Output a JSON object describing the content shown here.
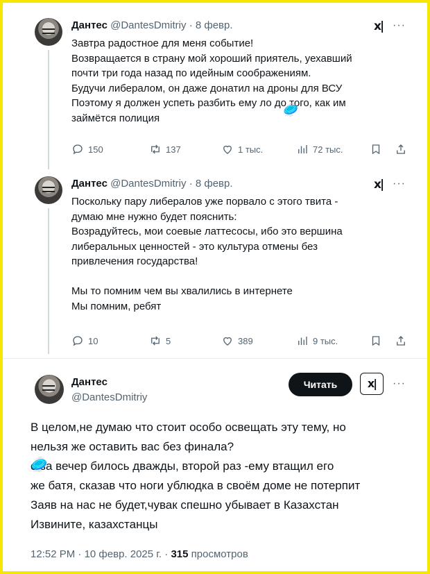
{
  "tweets": [
    {
      "name": "Дантес",
      "handle": "@DantesDmitriy",
      "dot": "·",
      "date": "8 февр.",
      "text": "Завтра радостное для меня событие!\nВозвращается в страну мой хороший приятель, уехавший\nпочти три года назад по идейным соображениям.\nБудучи либералом, он даже донатил на дроны для ВСУ\nПоэтому я должен успеть разбить ему      ло до того, как им\nзаймётся полиция",
      "replies": "150",
      "reposts": "137",
      "likes": "1 тыс.",
      "views": "72 тыс."
    },
    {
      "name": "Дантес",
      "handle": "@DantesDmitriy",
      "dot": "·",
      "date": "8 февр.",
      "text": "Поскольку пару либералов уже порвало с этого твита -\nдумаю мне нужно будет пояснить:\nВозрадуйтесь, мои соевые латтесосы, ибо это вершина\nлиберальных ценностей - это культура отмены без\nпривлечения государства!\n\nМы то помним чем вы хвалились в интернете\nМы помним, ребят",
      "replies": "10",
      "reposts": "5",
      "likes": "389",
      "views": "9 тыс."
    }
  ],
  "main": {
    "name": "Дантес",
    "handle": "@DantesDmitriy",
    "follow_label": "Читать",
    "text": "В целом,не думаю что стоит особо освещать эту тему, но\nнельзя же оставить вас без финала?\n     о за вечер билось дважды, второй раз -ему втащил его\nже батя, сказав что ноги ублюдка в своём доме не потерпит\nЗаяв на нас не будет,чувак спешно убывает в Казахстан\nИзвините, казахстанцы",
    "time": "12:52 PM",
    "dot": "·",
    "date": "10 февр. 2025 г.",
    "views_count": "315",
    "views_label": "просмотров"
  },
  "grok_label": "x|",
  "more_label": "···",
  "icons": {
    "reply": "reply-icon",
    "repost": "repost-icon",
    "like": "heart-icon",
    "views": "views-icon",
    "bookmark": "bookmark-icon",
    "share": "share-icon"
  },
  "colors": {
    "frame": "#f7e600",
    "text": "#0f1419",
    "muted": "#536471"
  }
}
